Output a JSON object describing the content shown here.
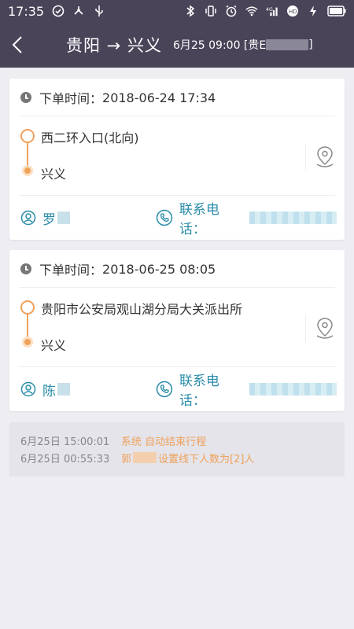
{
  "status_bar": {
    "time": "17:35",
    "left_icons": [
      "check-circle-icon",
      "usb-share-icon",
      "usb-icon"
    ],
    "right_icons": [
      "bluetooth-icon",
      "vibrate-icon",
      "alarm-icon",
      "wifi-icon",
      "signal-4g-icon",
      "hd-icon",
      "charging-icon",
      "battery-icon"
    ]
  },
  "nav": {
    "title": "贵阳 → 兴义",
    "subtitle_prefix": "6月25 09:00 [贵E",
    "subtitle_suffix": "]"
  },
  "orders": [
    {
      "time_label": "下单时间：",
      "time_value": "2018-06-24 17:34",
      "from": "西二环入口(北向)",
      "to": "兴义",
      "person_surname": "罗",
      "phone_label": "联系电话："
    },
    {
      "time_label": "下单时间：",
      "time_value": "2018-06-25 08:05",
      "from": "贵阳市公安局观山湖分局大关派出所",
      "to": "兴义",
      "person_surname": "陈",
      "phone_label": "联系电话："
    }
  ],
  "log": [
    {
      "time": "6月25日 15:00:01",
      "text": "系统 自动结束行程"
    },
    {
      "time": "6月25日 00:55:33",
      "prefix": "郭",
      "text": "设置线下人数为[2]人"
    }
  ],
  "colors": {
    "header_bg": "#4a4459",
    "accent_orange": "#f0a15a",
    "accent_teal": "#2a8ca8",
    "page_bg": "#ededf2"
  }
}
